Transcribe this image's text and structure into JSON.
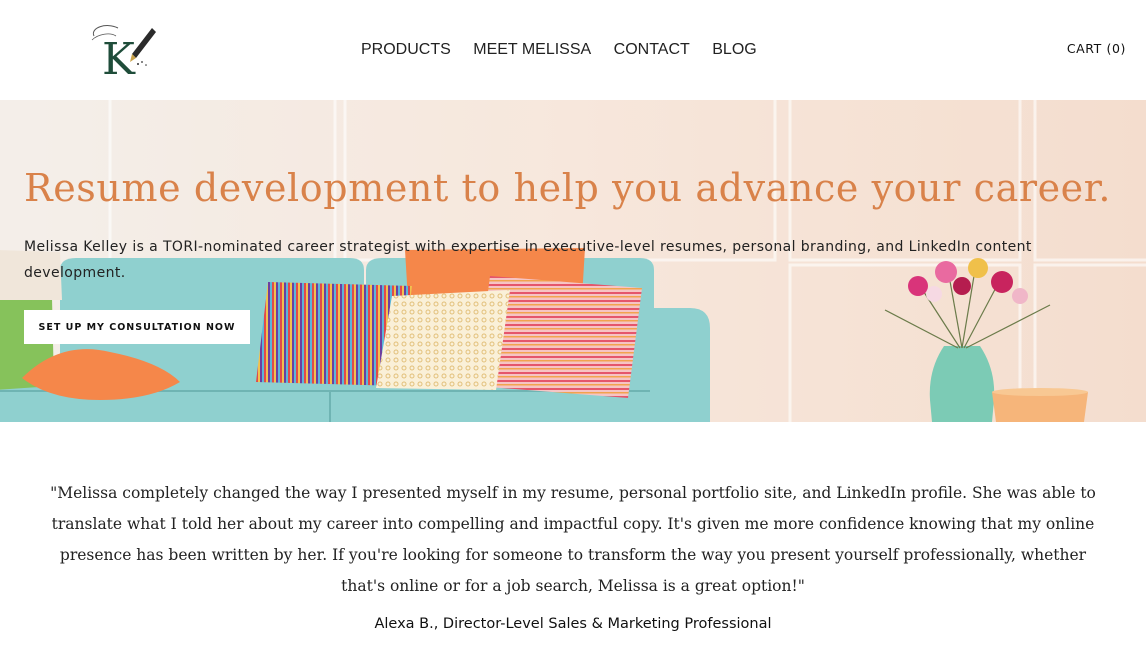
{
  "brand": {
    "logo_letter": "K"
  },
  "nav": {
    "items": [
      {
        "label": "PRODUCTS"
      },
      {
        "label": "MEET MELISSA"
      },
      {
        "label": "CONTACT"
      },
      {
        "label": "BLOG"
      }
    ],
    "cart_label": "CART (0)"
  },
  "hero": {
    "title": "Resume development to help you advance your career.",
    "subtitle": "Melissa Kelley is a TORI-nominated career strategist with expertise in executive-level resumes, personal branding, and LinkedIn content development.",
    "cta_label": "SET UP MY CONSULTATION NOW",
    "colors": {
      "title": "#d9824a",
      "sofa": "#8fd0cf",
      "pillow_orange": "#f5874a"
    }
  },
  "testimonial": {
    "quote": "\"Melissa completely changed the way I presented myself in my resume, personal portfolio site, and LinkedIn profile. She was able to translate what I told her about my career into compelling and impactful copy. It's given me more confidence knowing that my online presence has been written by her. If you're looking for someone to transform the way you present yourself professionally, whether that's online or for a job search, Melissa is a great option!\"",
    "author": "Alexa B., Director-Level Sales & Marketing Professional"
  }
}
